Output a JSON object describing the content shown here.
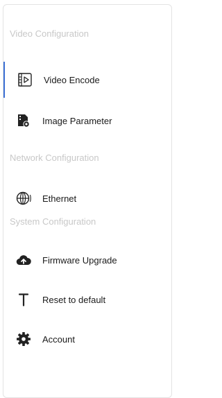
{
  "sidebar": {
    "sections": [
      {
        "title": "Video Configuration"
      },
      {
        "title": "Network Configuration"
      },
      {
        "title": "System Configuration"
      }
    ],
    "items": [
      {
        "label": "Video Encode",
        "icon": "video-encode-icon"
      },
      {
        "label": "Image Parameter",
        "icon": "image-parameter-icon"
      },
      {
        "label": "Ethernet",
        "icon": "globe-icon"
      },
      {
        "label": "Firmware Upgrade",
        "icon": "cloud-upload-icon"
      },
      {
        "label": "Reset to default",
        "icon": "reset-icon"
      },
      {
        "label": "Account",
        "icon": "gear-icon"
      }
    ]
  }
}
